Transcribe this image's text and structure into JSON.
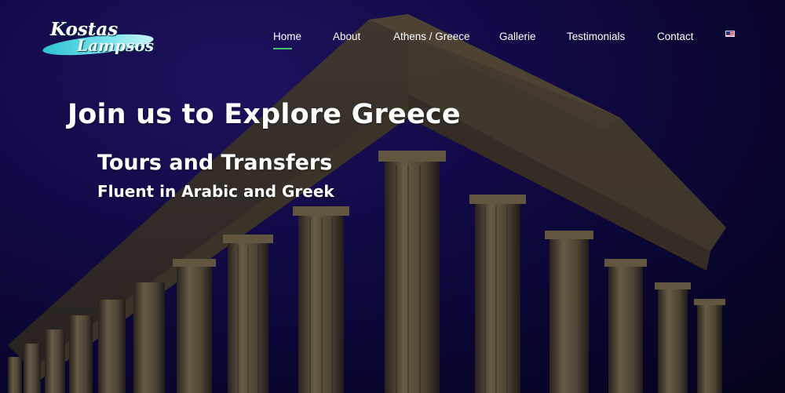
{
  "logo": {
    "line1": "Kostas",
    "line2": "Lampsos"
  },
  "nav": {
    "items": [
      {
        "label": "Home",
        "active": true
      },
      {
        "label": "About",
        "active": false
      },
      {
        "label": "Athens / Greece",
        "active": false
      },
      {
        "label": "Gallerie",
        "active": false
      },
      {
        "label": "Testimonials",
        "active": false
      },
      {
        "label": "Contact",
        "active": false
      }
    ],
    "language_icon": "us-flag-icon"
  },
  "hero": {
    "headline": "Join us to Explore Greece",
    "subheadline": "Tours and Transfers",
    "tagline": "Fluent in Arabic and Greek"
  },
  "colors": {
    "accent": "#3cc36b",
    "sky": "#1a0f5a",
    "logo_oval": "#4fd3e0",
    "text": "#ffffff"
  }
}
